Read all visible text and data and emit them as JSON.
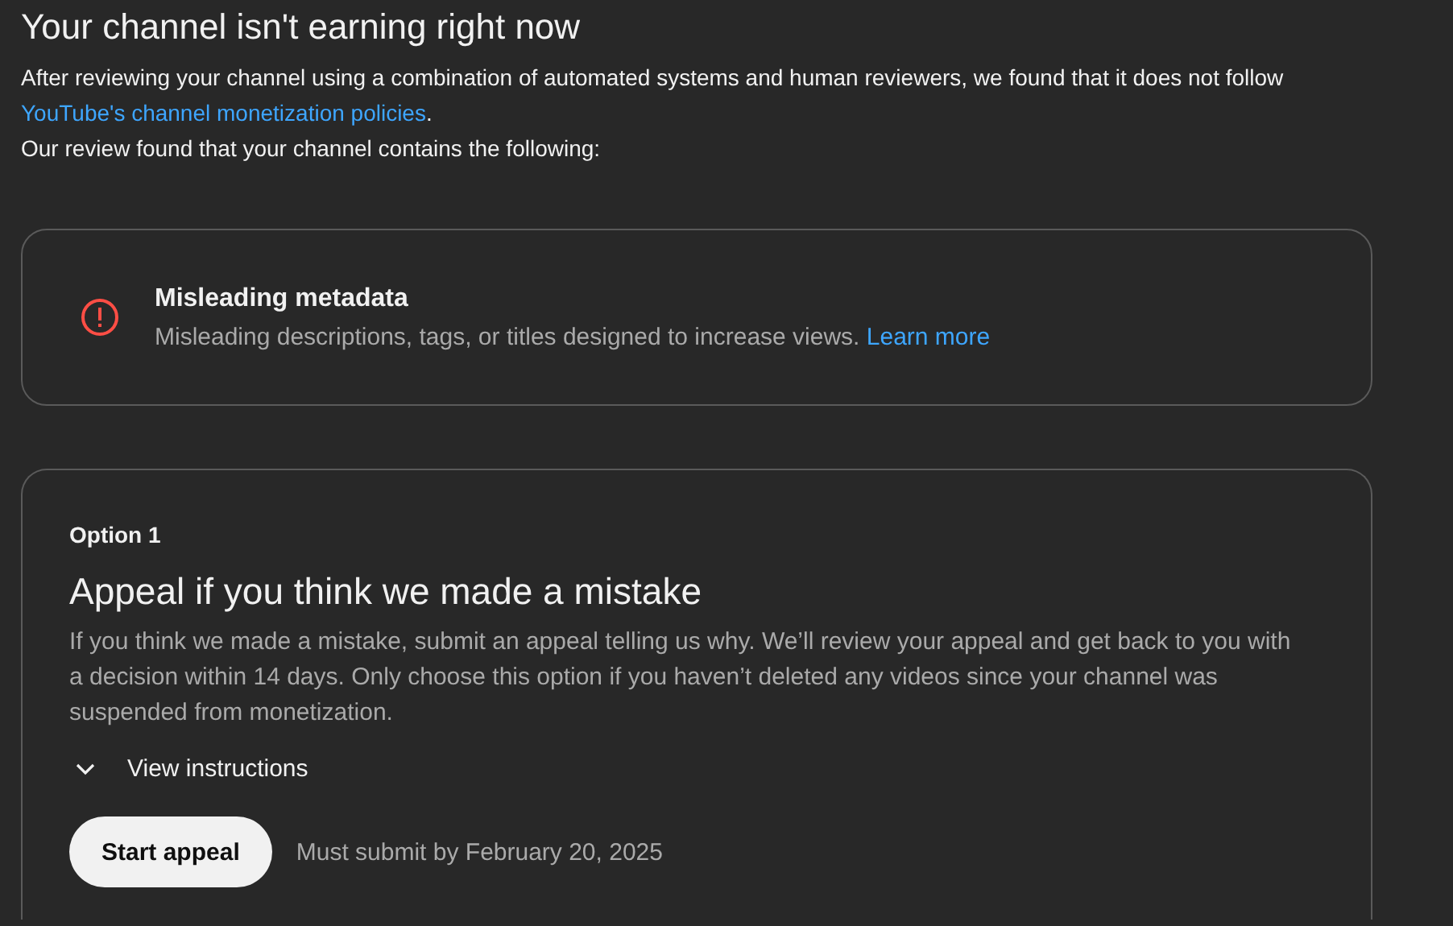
{
  "title": "Your channel isn't earning right now",
  "intro": {
    "before": "After reviewing your channel using a combination of automated systems and human reviewers, we found that it does not follow ",
    "link": "YouTube's channel monetization policies",
    "after": "."
  },
  "review_note": "Our review found that your channel contains the following:",
  "violation": {
    "title": "Misleading metadata",
    "description": "Misleading descriptions, tags, or titles designed to increase views.",
    "link": "Learn more"
  },
  "option": {
    "label": "Option 1",
    "heading": "Appeal if you think we made a mistake",
    "description": "If you think we made a mistake, submit an appeal telling us why. We’ll review your appeal and get back to you with a decision within 14 days. Only choose this option if you haven’t deleted any videos since your channel was suspended from monetization.",
    "instructions": {
      "label": "View instructions",
      "expanded": false
    },
    "button": "Start appeal",
    "deadline": "Must submit by February 20, 2025"
  }
}
